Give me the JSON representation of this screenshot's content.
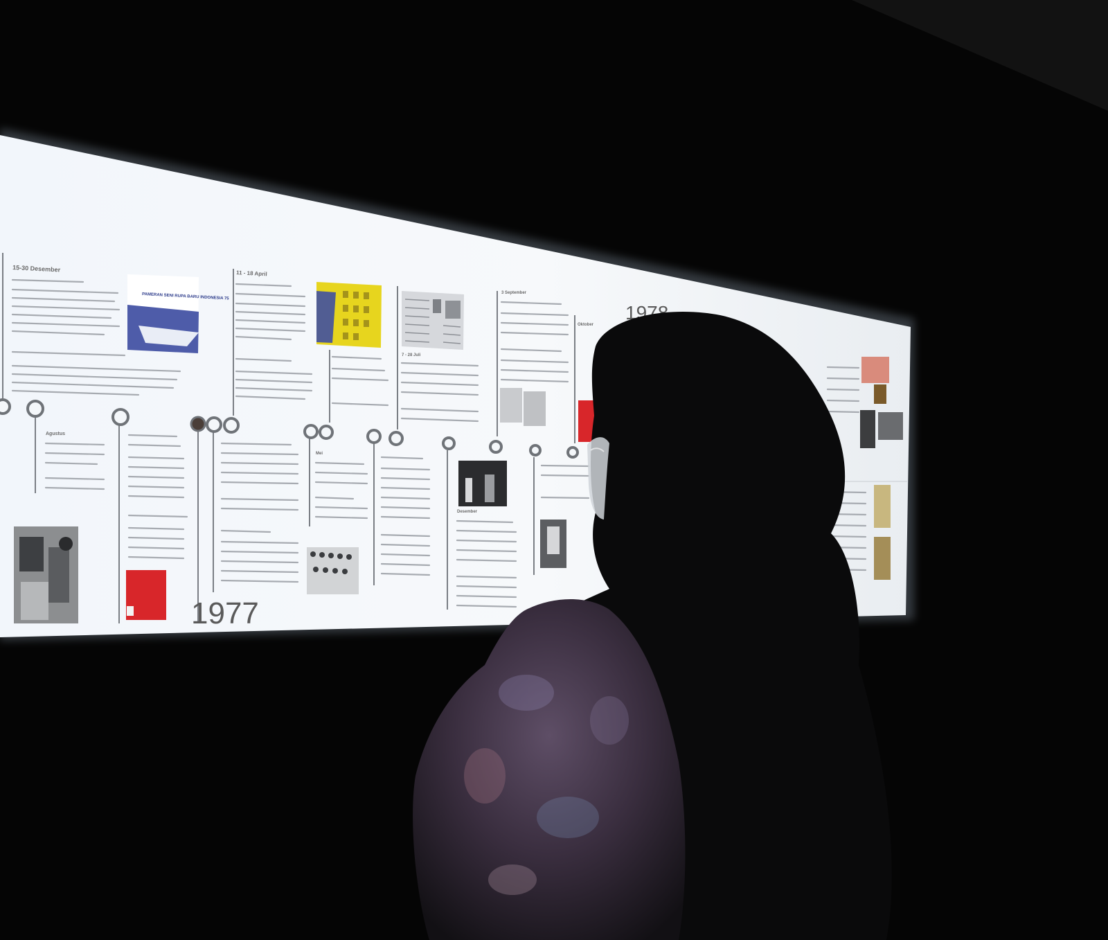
{
  "photo": {
    "background": "#050505",
    "panel_glow": "#eef3f8",
    "accent_red": "#d8262a",
    "text_grey": "#8a8e94"
  },
  "timeline": {
    "years": [
      "1977",
      "1978"
    ],
    "legible_dates": [
      "15-30 Desember",
      "11 - 18 April",
      "Agustus",
      "Mei",
      "Desember",
      "7 - 28 Juli",
      "3 September",
      "Oktober"
    ],
    "poster_text": "PAMERAN SENI RUPA BARU INDONESIA 75"
  }
}
